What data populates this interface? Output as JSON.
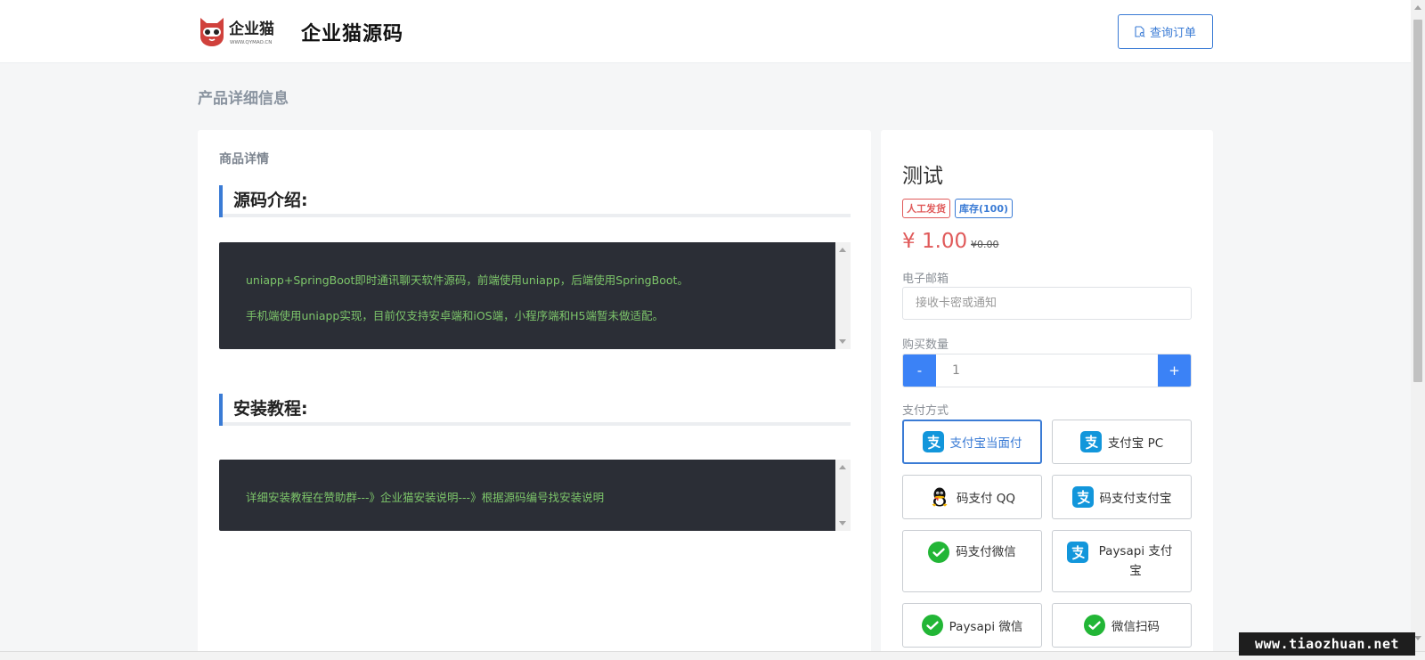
{
  "header": {
    "logo_text": "企业猫",
    "logo_sub": "WWW.QYMAO.CN",
    "site_title": "企业猫源码",
    "query_button": "查询订单"
  },
  "page_heading": "产品详细信息",
  "detail": {
    "card_label": "商品详情",
    "sections": [
      {
        "heading": "源码介绍:",
        "lines": [
          "uniapp+SpringBoot即时通讯聊天软件源码，前端使用uniapp，后端使用SpringBoot。",
          "手机端使用uniapp实现，目前仅支持安卓端和iOS端，小程序端和H5端暂未做适配。"
        ]
      },
      {
        "heading": "安装教程:",
        "lines": [
          "详细安装教程在赞助群---》企业猫安装说明---》根据源码编号找安装说明"
        ]
      }
    ]
  },
  "product": {
    "name": "测试",
    "badges": [
      "人工发货",
      "库存(100)"
    ],
    "price": "¥ 1.00",
    "old_price": "¥0.00",
    "email_label": "电子邮箱",
    "email_placeholder": "接收卡密或通知",
    "quantity_label": "购买数量",
    "quantity_value": "1",
    "minus_label": "-",
    "plus_label": "+",
    "payment_label": "支付方式",
    "payment_methods": [
      {
        "label": "支付宝当面付",
        "icon": "alipay-icon",
        "selected": true
      },
      {
        "label": "支付宝 PC",
        "icon": "alipay-icon"
      },
      {
        "label": "码支付 QQ",
        "icon": "qq-icon"
      },
      {
        "label": "码支付支付宝",
        "icon": "alipay-icon"
      },
      {
        "label": "码支付微信",
        "icon": "wechat-icon"
      },
      {
        "label": "Paysapi 支付宝",
        "icon": "alipay-icon"
      },
      {
        "label": "Paysapi 微信",
        "icon": "wechat-icon"
      },
      {
        "label": "微信扫码",
        "icon": "wechat-icon"
      }
    ]
  },
  "watermark": "www.tiaozhuan.net",
  "colors": {
    "accent": "#3a7bd5",
    "button_blue": "#3b82f6",
    "price_red": "#e05a5a",
    "code_bg": "#2b2e36",
    "code_text": "#7dc66a",
    "alipay": "#1296db",
    "wechat": "#22b636"
  }
}
